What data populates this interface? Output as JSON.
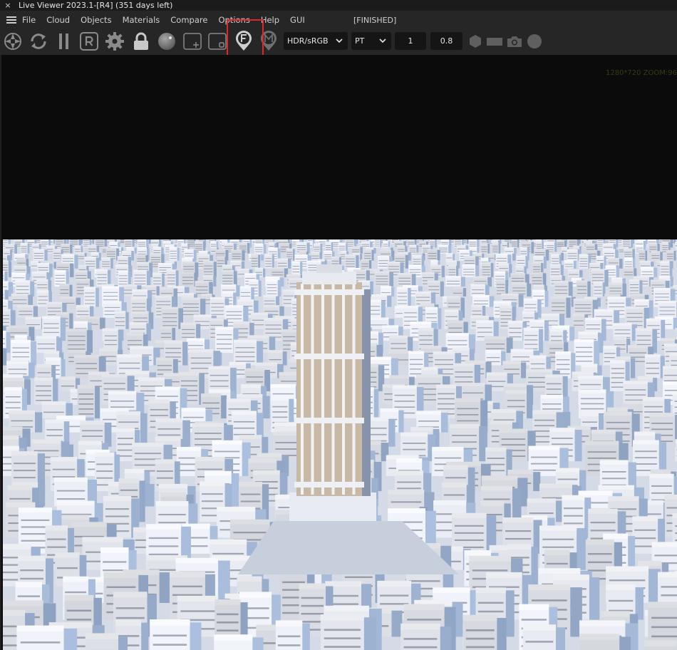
{
  "window": {
    "close_glyph": "×",
    "title": "Live Viewer 2023.1-[R4] (351 days left)"
  },
  "menu": {
    "items": [
      "File",
      "Cloud",
      "Objects",
      "Materials",
      "Compare",
      "Options",
      "Help",
      "GUI"
    ],
    "status": "[FINISHED]"
  },
  "toolbar": {
    "icons": [
      "aperture-icon",
      "refresh-icon",
      "pause-icon",
      "region-render-icon",
      "settings-gear-icon",
      "lock-icon",
      "sphere-icon",
      "add-pane-icon",
      "pane-icon",
      "focus-picker-icon",
      "material-picker-icon",
      "hexagon-icon",
      "rectangle-icon",
      "camera-icon",
      "circle-icon"
    ],
    "colorspace": "HDR/sRGB",
    "kernel": "PT",
    "value1": "1",
    "value2": "0.8"
  },
  "viewport": {
    "resolution_text": "1280*720 ZOOM:96"
  },
  "colors": {
    "highlight": "#e0282a",
    "toolbar_bg": "#262626",
    "viewport_bg": "#0b0b0b"
  }
}
